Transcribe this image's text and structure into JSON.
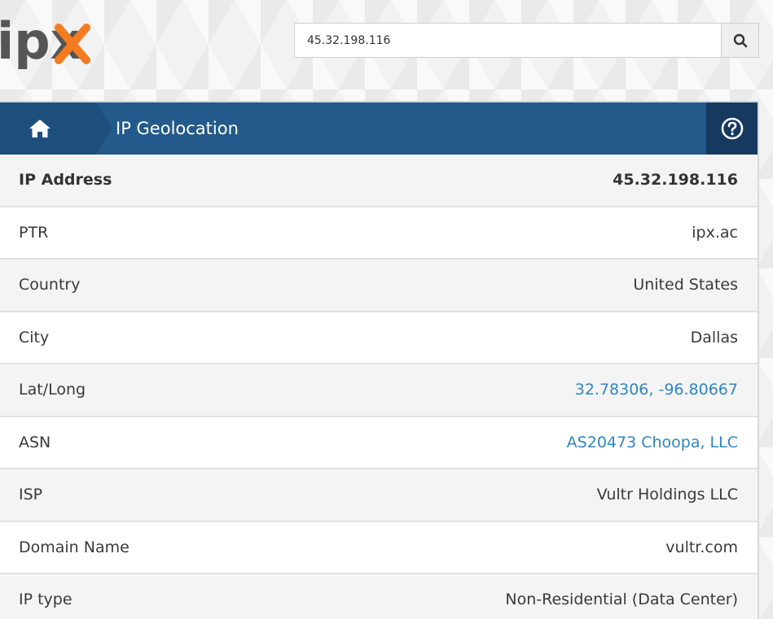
{
  "logo": {
    "text": "ipx"
  },
  "search": {
    "value": "45.32.198.116"
  },
  "header": {
    "title": "IP Geolocation"
  },
  "rows": [
    {
      "label": "IP Address",
      "value": "45.32.198.116"
    },
    {
      "label": "PTR",
      "value": "ipx.ac"
    },
    {
      "label": "Country",
      "value": "United States"
    },
    {
      "label": "City",
      "value": "Dallas"
    },
    {
      "label": "Lat/Long",
      "value": "32.78306, -96.80667"
    },
    {
      "label": "ASN",
      "value": "AS20473 Choopa, LLC"
    },
    {
      "label": "ISP",
      "value": "Vultr Holdings LLC"
    },
    {
      "label": "Domain Name",
      "value": "vultr.com"
    },
    {
      "label": "IP type",
      "value": "Non-Residential (Data Center)"
    }
  ],
  "colors": {
    "header_blue": "#235a8b",
    "home_blue": "#1d4f7d",
    "help_navy": "#163a5f",
    "link_blue": "#2f86c4",
    "logo_gray": "#555555",
    "logo_orange": "#f47b20"
  },
  "icons": {
    "search": "magnifier-icon",
    "home": "home-icon",
    "help": "question-circle-icon"
  }
}
